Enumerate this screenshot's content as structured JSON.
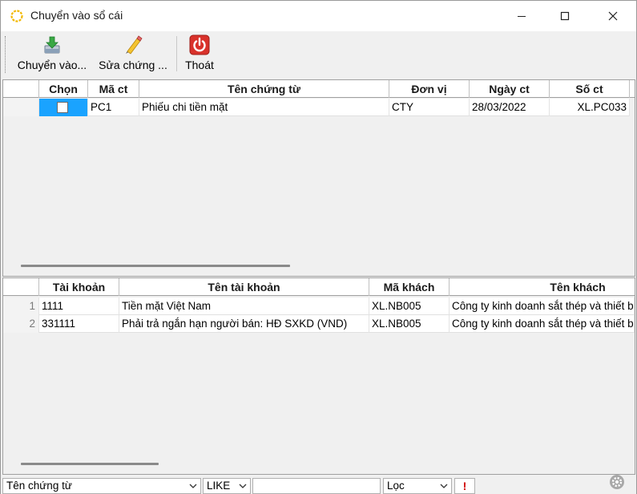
{
  "window": {
    "title": "Chuyển vào sổ cái"
  },
  "toolbar": {
    "transfer_label": "Chuyển vào...",
    "edit_label": "Sửa chứng ...",
    "exit_label": "Thoát"
  },
  "vouchers": {
    "columns": [
      "Chọn",
      "Mã ct",
      "Tên chứng từ",
      "Đơn vị",
      "Ngày ct",
      "Số ct"
    ],
    "rows": [
      {
        "selected": false,
        "ma_ct": "PC1",
        "ten": "Phiếu chi tiền mặt",
        "don_vi": "CTY",
        "ngay": "28/03/2022",
        "so_ct": "XL.PC033"
      }
    ]
  },
  "accounts": {
    "columns": [
      "Tài khoản",
      "Tên tài khoản",
      "Mã khách",
      "Tên khách"
    ],
    "rows": [
      {
        "num": "1",
        "tk": "1111",
        "ten_tk": "Tiền mặt Việt Nam",
        "ma_kh": "XL.NB005",
        "ten_kh": "Công ty kinh doanh sắt thép và thiết b"
      },
      {
        "num": "2",
        "tk": "331111",
        "ten_tk": "Phải trả ngắn hạn người bán: HĐ SXKD (VND)",
        "ma_kh": "XL.NB005",
        "ten_kh": "Công ty kinh doanh sắt thép và thiết b"
      }
    ]
  },
  "filter": {
    "field": "Tên chứng từ",
    "operator": "LIKE",
    "value": "",
    "mode": "Lọc",
    "warn": "!"
  }
}
